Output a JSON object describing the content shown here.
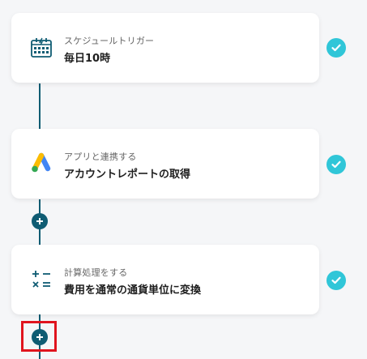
{
  "flow": {
    "steps": [
      {
        "subtitle": "スケジュールトリガー",
        "title": "毎日10時",
        "icon": "calendar-icon",
        "status": "complete"
      },
      {
        "subtitle": "アプリと連携する",
        "title": "アカウントレポートの取得",
        "icon": "google-ads-icon",
        "status": "complete"
      },
      {
        "subtitle": "計算処理をする",
        "title": "費用を通常の通貨単位に変換",
        "icon": "calculator-icon",
        "status": "complete"
      }
    ],
    "add_step_icon": "plus-icon"
  },
  "colors": {
    "connector": "#0f5c73",
    "check": "#30c6d8",
    "highlight": "#e0141e",
    "google_blue": "#4285f4",
    "google_yellow": "#fbbc04",
    "google_green": "#34a853"
  }
}
